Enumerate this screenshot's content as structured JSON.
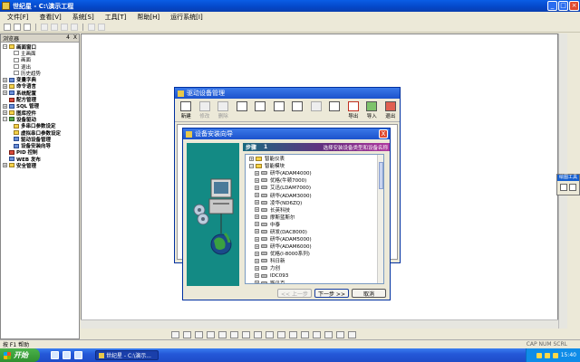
{
  "window": {
    "title": "世纪星 - C:\\演示工程"
  },
  "menu": [
    "文件[F]",
    "查看[V]",
    "系统[S]",
    "工具[T]",
    "帮助[H]",
    "运行系统[I]"
  ],
  "left_panel": {
    "title": "浏览器",
    "pin": "4",
    "close": "X",
    "tree": [
      {
        "label": "画面窗口",
        "bold": true,
        "exp": "−",
        "icon": "yellow",
        "level": 0
      },
      {
        "label": "主画面",
        "bold": false,
        "icon": "doc",
        "level": 1
      },
      {
        "label": "画面",
        "bold": false,
        "icon": "doc",
        "level": 1
      },
      {
        "label": "退出",
        "bold": false,
        "icon": "doc",
        "level": 1
      },
      {
        "label": "历史趋势",
        "bold": false,
        "icon": "doc",
        "level": 1
      },
      {
        "label": "变量字典",
        "bold": true,
        "exp": "+",
        "icon": "blue",
        "level": 0
      },
      {
        "label": "命令语言",
        "bold": true,
        "exp": "+",
        "icon": "yellow",
        "level": 0
      },
      {
        "label": "系统配置",
        "bold": true,
        "exp": "+",
        "icon": "blue",
        "level": 0
      },
      {
        "label": "配方管理",
        "bold": true,
        "exp": "",
        "icon": "red",
        "level": 0
      },
      {
        "label": "SQL 管理",
        "bold": true,
        "exp": "+",
        "icon": "blue",
        "level": 0
      },
      {
        "label": "图库控件",
        "bold": true,
        "exp": "+",
        "icon": "yellow",
        "level": 0
      },
      {
        "label": "设备驱动",
        "bold": true,
        "exp": "−",
        "icon": "green",
        "level": 0
      },
      {
        "label": "多串口参数设定",
        "bold": true,
        "icon": "yellow",
        "level": 1
      },
      {
        "label": "虚拟串口参数设定",
        "bold": true,
        "icon": "yellow",
        "level": 1
      },
      {
        "label": "驱动设备管理",
        "bold": true,
        "icon": "blue",
        "level": 1
      },
      {
        "label": "设备安装向导",
        "bold": true,
        "icon": "blue",
        "level": 1
      },
      {
        "label": "PID 控制",
        "bold": true,
        "exp": "",
        "icon": "red",
        "level": 0
      },
      {
        "label": "WEB 发布",
        "bold": true,
        "exp": "",
        "icon": "blue",
        "level": 0
      },
      {
        "label": "安全管理",
        "bold": true,
        "exp": "+",
        "icon": "yellow",
        "level": 0
      }
    ]
  },
  "device_manager": {
    "title": "驱动设备管理",
    "toolbar": [
      {
        "label": "新建",
        "dim": false,
        "color": ""
      },
      {
        "label": "修改",
        "dim": true,
        "color": ""
      },
      {
        "label": "删除",
        "dim": true,
        "color": ""
      },
      {
        "label": "",
        "dim": false,
        "color": ""
      },
      {
        "label": "",
        "dim": false,
        "color": ""
      },
      {
        "label": "",
        "dim": false,
        "color": ""
      },
      {
        "label": "",
        "dim": false,
        "color": ""
      },
      {
        "label": "",
        "dim": true,
        "color": ""
      },
      {
        "label": "",
        "dim": false,
        "color": ""
      },
      {
        "label": "导出",
        "dim": false,
        "color": "redarrow"
      },
      {
        "label": "导入",
        "dim": false,
        "color": "green"
      },
      {
        "label": "退出",
        "dim": false,
        "color": "red"
      }
    ]
  },
  "wizard": {
    "title": "设备安装向导",
    "close": "X",
    "step_label": "步骤",
    "step_number": "1",
    "hint": "选择安装设备类型和设备名称",
    "list": [
      {
        "label": "智能仪表",
        "level": 1,
        "exp": "+"
      },
      {
        "label": "智能模块",
        "level": 1,
        "exp": "−"
      },
      {
        "label": "研华(ADAM4000)",
        "level": 2,
        "exp": "+"
      },
      {
        "label": "优格(牛顿7000)",
        "level": 2,
        "exp": "+"
      },
      {
        "label": "艾迅(LDAM7000)",
        "level": 2,
        "exp": "+"
      },
      {
        "label": "研华(ADAM3000)",
        "level": 2,
        "exp": "+"
      },
      {
        "label": "凌华(ND6ZQ)",
        "level": 2,
        "exp": "+"
      },
      {
        "label": "长英科技",
        "level": 2,
        "exp": "+"
      },
      {
        "label": "摩斯蓝斯尔",
        "level": 2,
        "exp": "+"
      },
      {
        "label": "中泰",
        "level": 2,
        "exp": "+"
      },
      {
        "label": "研发(DAC8000)",
        "level": 2,
        "exp": "+"
      },
      {
        "label": "研华(ADAM5000)",
        "level": 2,
        "exp": "+"
      },
      {
        "label": "研华(ADAM6000)",
        "level": 2,
        "exp": "+"
      },
      {
        "label": "优格(I-8000系列)",
        "level": 2,
        "exp": "+"
      },
      {
        "label": "科日新",
        "level": 2,
        "exp": "+"
      },
      {
        "label": "力创",
        "level": 2,
        "exp": "+"
      },
      {
        "label": "IDC093",
        "level": 2,
        "exp": "+"
      },
      {
        "label": "斯贝克",
        "level": 2,
        "exp": "+"
      }
    ],
    "buttons": {
      "back": "<< 上一步",
      "next": "下一步 >>",
      "cancel": "取消"
    }
  },
  "draw_tool": {
    "title": "绘图工具"
  },
  "status": {
    "left": "按 F1 帮助",
    "right": "CAP  NUM  SCRL"
  },
  "taskbar": {
    "start": "开始",
    "task_item": "世纪星 - C:\\演示...",
    "clock": "15:40"
  }
}
